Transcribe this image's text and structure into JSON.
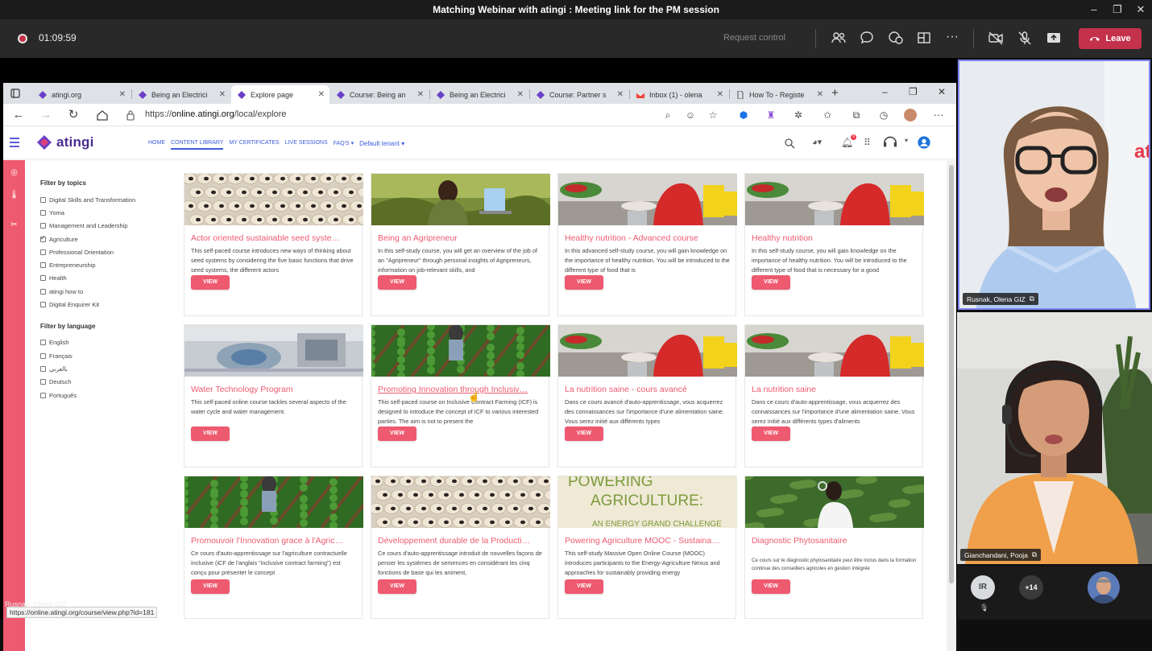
{
  "teams": {
    "window_title": "Matching Webinar with atingi : Meeting link for the PM session",
    "timer": "01:09:59",
    "request_control": "Request control",
    "leave_label": "Leave"
  },
  "browser": {
    "tabs": [
      {
        "label": "atingi.org",
        "icon": "atingi-favicon"
      },
      {
        "label": "Being an Electrici",
        "icon": "atingi-favicon"
      },
      {
        "label": "Explore page",
        "icon": "atingi-favicon",
        "active": true
      },
      {
        "label": "Course: Being an",
        "icon": "atingi-favicon"
      },
      {
        "label": "Being an Electrici",
        "icon": "atingi-favicon"
      },
      {
        "label": "Course: Partner s",
        "icon": "atingi-favicon"
      },
      {
        "label": "Inbox (1) - olena",
        "icon": "gmail-favicon"
      },
      {
        "label": "How To - Registe",
        "icon": "document-favicon"
      }
    ],
    "url_prefix": "https://",
    "url_host": "online.atingi.org",
    "url_path": "/local/explore",
    "status_url": "https://online.atingi.org/course/view.php?id=181"
  },
  "site": {
    "logo_text": "atingi",
    "menu": [
      "HOME",
      "CONTENT LIBRARY",
      "MY CERTIFICATES",
      "LIVE SESSIONS",
      "FAQ'S ▾"
    ],
    "tenant": "Default tenant ▾",
    "notification_count": "9",
    "accent": "#ee5a6f",
    "brand": "#4a2d8f"
  },
  "filters": {
    "topics_title": "Filter by topics",
    "topics": [
      {
        "label": "Digital Skills and Transformation",
        "checked": false
      },
      {
        "label": "Yoma",
        "checked": false
      },
      {
        "label": "Management and Leadership",
        "checked": false
      },
      {
        "label": "Agriculture",
        "checked": true
      },
      {
        "label": "Professional Orientation",
        "checked": false
      },
      {
        "label": "Entrepreneurship",
        "checked": false
      },
      {
        "label": "Health",
        "checked": false
      },
      {
        "label": "atingi how to",
        "checked": false
      },
      {
        "label": "Digital Enquirer Kit",
        "checked": false
      }
    ],
    "language_title": "Filter by language",
    "languages": [
      {
        "label": "English",
        "checked": false
      },
      {
        "label": "Français",
        "checked": false
      },
      {
        "label": "بالعربي",
        "checked": false
      },
      {
        "label": "Deutsch",
        "checked": false
      },
      {
        "label": "Português",
        "checked": false
      }
    ]
  },
  "courses": [
    {
      "title": "Actor oriented sustainable seed syste…",
      "desc": "This self-paced course introduces new ways of thinking about seed systems by considering the five basic functions that drive seed systems, the different actors",
      "image": "beans",
      "view": "VIEW"
    },
    {
      "title": "Being an Agripreneur",
      "desc": "In this self-study course, you will get an overview of the job of an \"Agripreneur\" through personal insights of Agripreneurs, information on job-relevant skills, and",
      "image": "agripreneur",
      "view": "VIEW"
    },
    {
      "title": "Healthy nutrition - Advanced course",
      "desc": "In this advanced self-study course, you will gain knowledge on the importance of healthy nutrition. You will be introduced to the different type of food that is",
      "image": "market",
      "view": "VIEW"
    },
    {
      "title": "Healthy nutrition",
      "desc": "In this self-study course, you will gain knowledge on the importance of healthy nutrition. You will be introduced to the different type of food that is necessary for a good",
      "image": "market",
      "view": "VIEW"
    },
    {
      "title": "Water Technology Program",
      "desc": "This self-paced online course tackles several aspects of the water cycle and water management.",
      "image": "water",
      "view": "VIEW"
    },
    {
      "title": "Promoting Innovation through Inclusiv…",
      "desc": "This self-paced course on Inclusive Contract Farming (ICF) is designed to introduce the concept of ICF to various interested parties. The aim is not to present the",
      "image": "field",
      "view": "VIEW",
      "hover": true
    },
    {
      "title": "La nutrition saine - cours avancé",
      "desc": "Dans ce cours avancé d'auto-apprentissage, vous acquerrez des connaissances sur l'importance d'une alimentation saine. Vous serez initié aux différents types",
      "image": "market",
      "view": "VIEW"
    },
    {
      "title": "La nutrition saine",
      "desc": "Dans ce cours d'auto-apprentissage, vous acquerrez des connaissances sur l'importance d'une alimentation saine. Vous serez initié aux différents types d'aliments",
      "image": "market",
      "view": "VIEW"
    },
    {
      "title": "Promouvoir l'Innovation grace à l'Agric…",
      "desc": "Ce cours d'auto-apprentissage sur l'agriculture contractuelle inclusive (iCF de l'anglais \"inclusive contract farming\") est conçu pour présenter le concept",
      "image": "field",
      "view": "VIEW"
    },
    {
      "title": "Développement durable de la Producti…",
      "desc": "Ce cours d'auto-apprentissage introduit de nouvelles façons de penser les systèmes de semences en considérant les cinq fonctions de base qui les animent,",
      "image": "beans",
      "view": "VIEW"
    },
    {
      "title": "Powering Agriculture MOOC - Sustaina…",
      "desc": "This self-study Massive Open Online Course (MOOC) introduces participants to the Energy-Agriculture Nexus and approaches for sustainably providing energy",
      "image": "powering",
      "view": "VIEW",
      "image_text_1": "POWERING",
      "image_text_2": "AGRICULTURE:",
      "image_text_3": "AN ENERGY GRAND CHALLENGE"
    },
    {
      "title": "Diagnostic Phytosanitaire",
      "desc": "Ce cours sur le diagnostic phytosanitaire peut être inclus dans la formation continue des conseillers agricoles en gestion intégrée",
      "image": "phyto",
      "view": "VIEW",
      "small": true
    }
  ],
  "participants": {
    "tile1_name": "Rusnak, Olena GIZ",
    "tile2_name": "Gianchandani, Pooja",
    "presenter_name": "Rusnak, Olena GIZ",
    "roster_initials": "IR",
    "more_count": "+14"
  }
}
